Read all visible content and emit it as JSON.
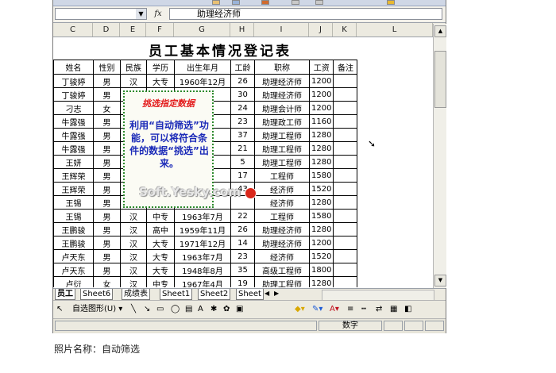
{
  "formula_bar": {
    "fx_label": "fx",
    "content": "助理经济师"
  },
  "column_headers": [
    "C",
    "D",
    "E",
    "F",
    "G",
    "H",
    "I",
    "J",
    "K",
    "L"
  ],
  "sheet_title": "员工基本情况登记表",
  "table": {
    "headers": [
      "姓名",
      "性别",
      "民族",
      "学历",
      "出生年月",
      "工龄",
      "职称",
      "工资",
      "备注"
    ],
    "rows": [
      [
        "丁骏婷",
        "男",
        "汉",
        "大专",
        "1960年12月",
        "26",
        "助理经济师",
        "1200",
        ""
      ],
      [
        "丁骏婷",
        "男",
        "",
        "",
        "月",
        "30",
        "助理经济师",
        "1200",
        ""
      ],
      [
        "刁志",
        "女",
        "",
        "",
        "月",
        "24",
        "助理会计师",
        "1200",
        ""
      ],
      [
        "牛露强",
        "男",
        "",
        "",
        "月",
        "23",
        "助理政工师",
        "1160",
        ""
      ],
      [
        "牛露强",
        "男",
        "",
        "",
        "月",
        "37",
        "助理工程师",
        "1280",
        ""
      ],
      [
        "牛露强",
        "男",
        "",
        "",
        "月",
        "21",
        "助理工程师",
        "1280",
        ""
      ],
      [
        "王妍",
        "男",
        "",
        "",
        "月",
        "5",
        "助理工程师",
        "1280",
        ""
      ],
      [
        "王辉荣",
        "男",
        "",
        "",
        "月",
        "17",
        "工程师",
        "1580",
        ""
      ],
      [
        "王辉荣",
        "男",
        "",
        "",
        "月",
        "43",
        "经济师",
        "1520",
        ""
      ],
      [
        "王锡",
        "男",
        "",
        "",
        "月",
        "",
        "经济师",
        "1280",
        ""
      ],
      [
        "王锡",
        "男",
        "汉",
        "中专",
        "1963年7月",
        "22",
        "工程师",
        "1580",
        ""
      ],
      [
        "王鹏骏",
        "男",
        "汉",
        "高中",
        "1959年11月",
        "26",
        "助理经济师",
        "1280",
        ""
      ],
      [
        "王鹏骏",
        "男",
        "汉",
        "大专",
        "1971年12月",
        "14",
        "助理经济师",
        "1200",
        ""
      ],
      [
        "卢天东",
        "男",
        "汉",
        "大专",
        "1963年7月",
        "23",
        "经济师",
        "1520",
        ""
      ],
      [
        "卢天东",
        "男",
        "汉",
        "大专",
        "1948年8月",
        "35",
        "高级工程师",
        "1800",
        ""
      ],
      [
        "卢衍",
        "女",
        "汉",
        "中专",
        "1967年4月",
        "19",
        "助理工程师",
        "1280",
        ""
      ]
    ]
  },
  "callout": {
    "title": "挑选指定数据",
    "body": "利用“自动筛选”功能，可以将符合条件的数据“挑选”出来。"
  },
  "watermark": "Soft.Yesky.com",
  "sheet_tabs": [
    "员工",
    "Sheet6",
    "成绩表",
    "Sheet1",
    "Sheet2",
    "Sheet"
  ],
  "draw_toolbar": {
    "autoshape_label": "自选图形(U) ▾"
  },
  "status_bar": {
    "mode": "数字"
  },
  "caption": "照片名称：自动筛选"
}
